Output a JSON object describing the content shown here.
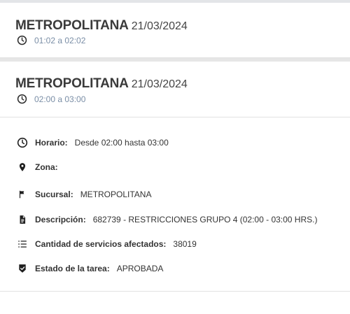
{
  "cards": [
    {
      "title": "METROPOLITANA",
      "date": "21/03/2024",
      "time": "01:02 a 02:02"
    },
    {
      "title": "METROPOLITANA",
      "date": "21/03/2024",
      "time": "02:00 a 03:00"
    }
  ],
  "details": {
    "horario": {
      "label": "Horario:",
      "value": "Desde 02:00 hasta 03:00",
      "icon": "clock-icon"
    },
    "zona": {
      "label": "Zona:",
      "value": "",
      "icon": "location-pin-icon"
    },
    "sucursal": {
      "label": "Sucursal:",
      "value": "METROPOLITANA",
      "icon": "flag-icon"
    },
    "descripcion": {
      "label": "Descripción:",
      "value": "682739 - RESTRICCIONES GRUPO 4 (02:00 - 03:00 HRS.)",
      "icon": "document-icon"
    },
    "cantidad": {
      "label": "Cantidad de servicios afectados:",
      "value": "38019",
      "icon": "numbered-list-icon"
    },
    "estado": {
      "label": "Estado de la tarea:",
      "value": "APROBADA",
      "icon": "verified-shield-icon"
    }
  },
  "colors": {
    "time_text": "#7a8ea6",
    "title": "#3a3a3a",
    "divider": "#e2e2e2"
  }
}
